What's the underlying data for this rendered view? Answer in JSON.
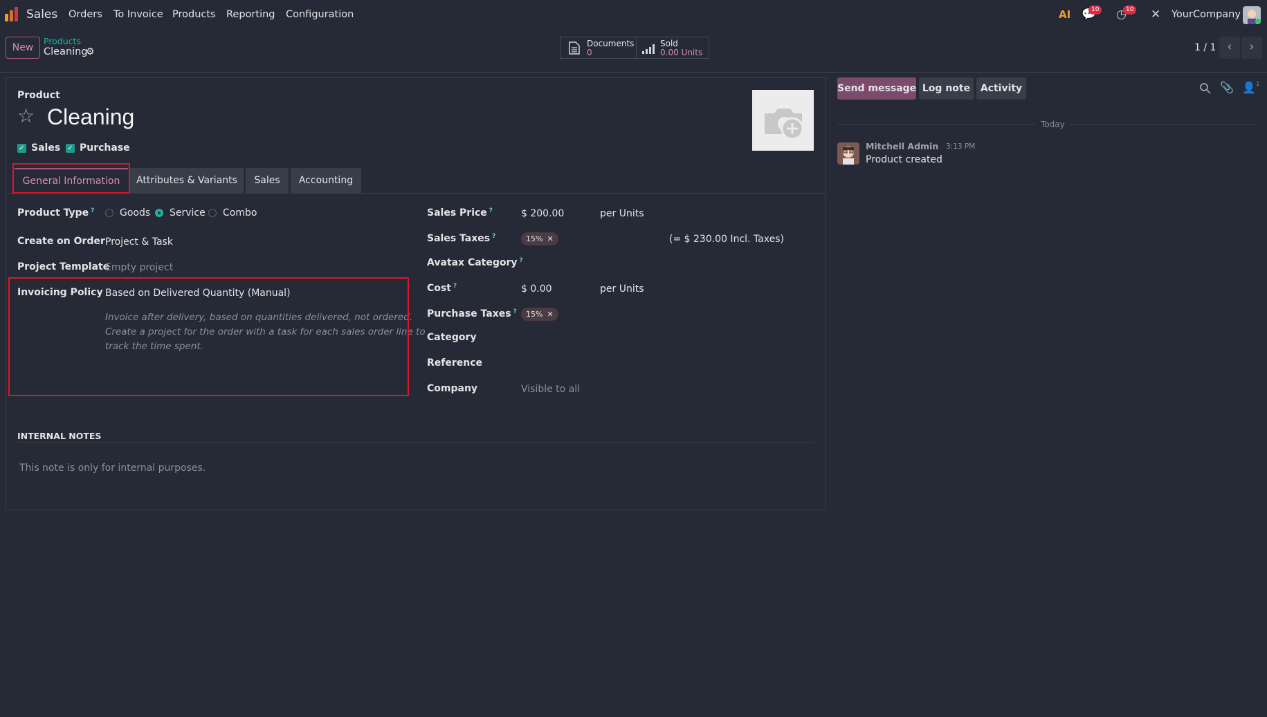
{
  "navbar": {
    "app_name": "Sales",
    "menu": [
      "Orders",
      "To Invoice",
      "Products",
      "Reporting",
      "Configuration"
    ],
    "messages_count": "10",
    "activities_count": "10",
    "company": "YourCompany",
    "ai_label": "AI"
  },
  "control": {
    "new_label": "New",
    "breadcrumb_parent": "Products",
    "record_name": "Cleaning",
    "stats": {
      "documents_label": "Documents",
      "documents_value": "0",
      "sold_label": "Sold",
      "sold_value": "0.00 Units"
    },
    "pager": "1 / 1"
  },
  "form": {
    "product_label": "Product",
    "name": "Cleaning",
    "sales_check_label": "Sales",
    "purchase_check_label": "Purchase",
    "tabs": [
      "General Information",
      "Attributes & Variants",
      "Sales",
      "Accounting"
    ],
    "left": {
      "product_type_label": "Product Type",
      "product_type_options": [
        "Goods",
        "Service",
        "Combo"
      ],
      "product_type_selected": "Service",
      "create_on_order_label": "Create on Order",
      "create_on_order_value": "Project & Task",
      "project_template_label": "Project Template",
      "project_template_placeholder": "Empty project",
      "invoicing_policy_label": "Invoicing Policy",
      "invoicing_policy_value": "Based on Delivered Quantity (Manual)",
      "invoicing_policy_help_1": "Invoice after delivery, based on quantities delivered, not ordered.",
      "invoicing_policy_help_2": "Create a project for the order with a task for each sales order line to",
      "invoicing_policy_help_3": "track the time spent."
    },
    "right": {
      "sales_price_label": "Sales Price",
      "sales_price_value": "$ 200.00",
      "sales_price_uom": "per Units",
      "sales_taxes_label": "Sales Taxes",
      "sales_tax_tag": "15%",
      "incl_taxes": "(= $ 230.00 Incl. Taxes)",
      "avatax_category_label": "Avatax Category",
      "cost_label": "Cost",
      "cost_value": "$ 0.00",
      "cost_uom": "per Units",
      "purchase_taxes_label": "Purchase Taxes",
      "purchase_tax_tag": "15%",
      "category_label": "Category",
      "reference_label": "Reference",
      "company_label": "Company",
      "company_placeholder": "Visible to all"
    },
    "internal_notes_title": "INTERNAL NOTES",
    "internal_notes_placeholder": "This note is only for internal purposes.",
    "help_mark": "?"
  },
  "chatter": {
    "send_message": "Send message",
    "log_note": "Log note",
    "activity": "Activity",
    "followers_count": "1",
    "date_separator": "Today",
    "message_author": "Mitchell Admin",
    "message_time": "3:13 PM",
    "message_body": "Product created"
  },
  "colors": {
    "accent": "#d78fb2",
    "teal": "#1fb3a6",
    "highlight": "#e21426",
    "background": "#262a36"
  }
}
